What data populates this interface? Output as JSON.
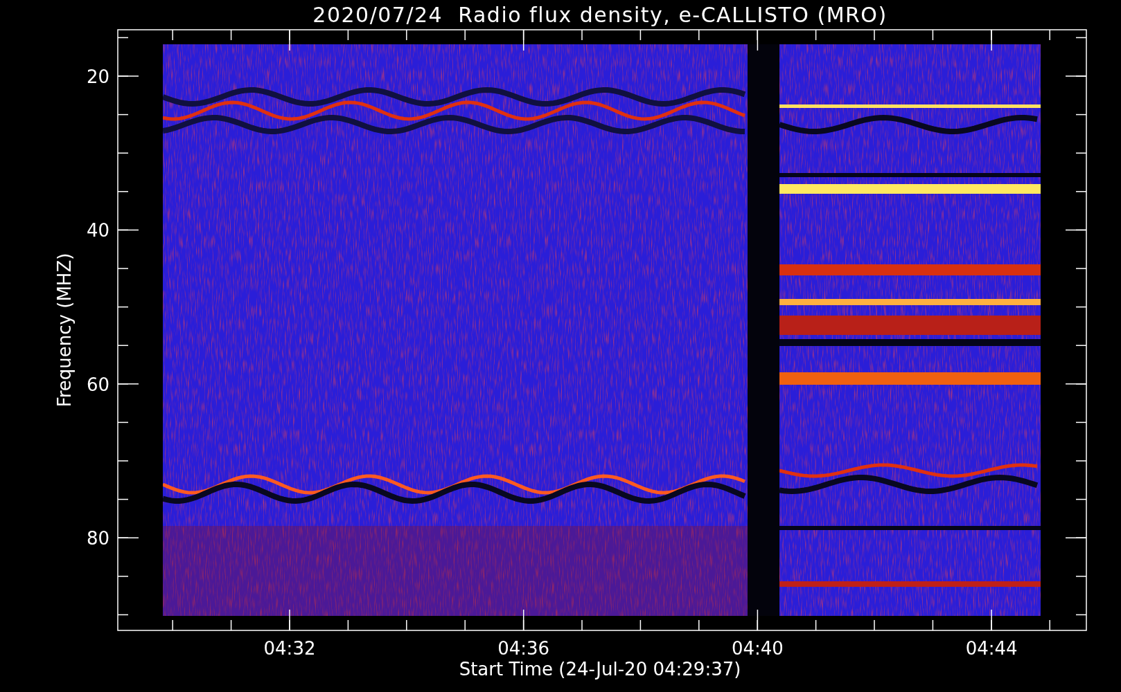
{
  "title": "2020/07/24  Radio flux density, e-CALLISTO (MRO)",
  "y_axis": {
    "label": "Frequency (MHZ)",
    "ticks": [
      "20",
      "40",
      "60",
      "80"
    ]
  },
  "x_axis": {
    "label": "Start Time (24-Jul-20 04:29:37)",
    "ticks": [
      "04:32",
      "04:36",
      "04:40",
      "04:44"
    ]
  }
}
